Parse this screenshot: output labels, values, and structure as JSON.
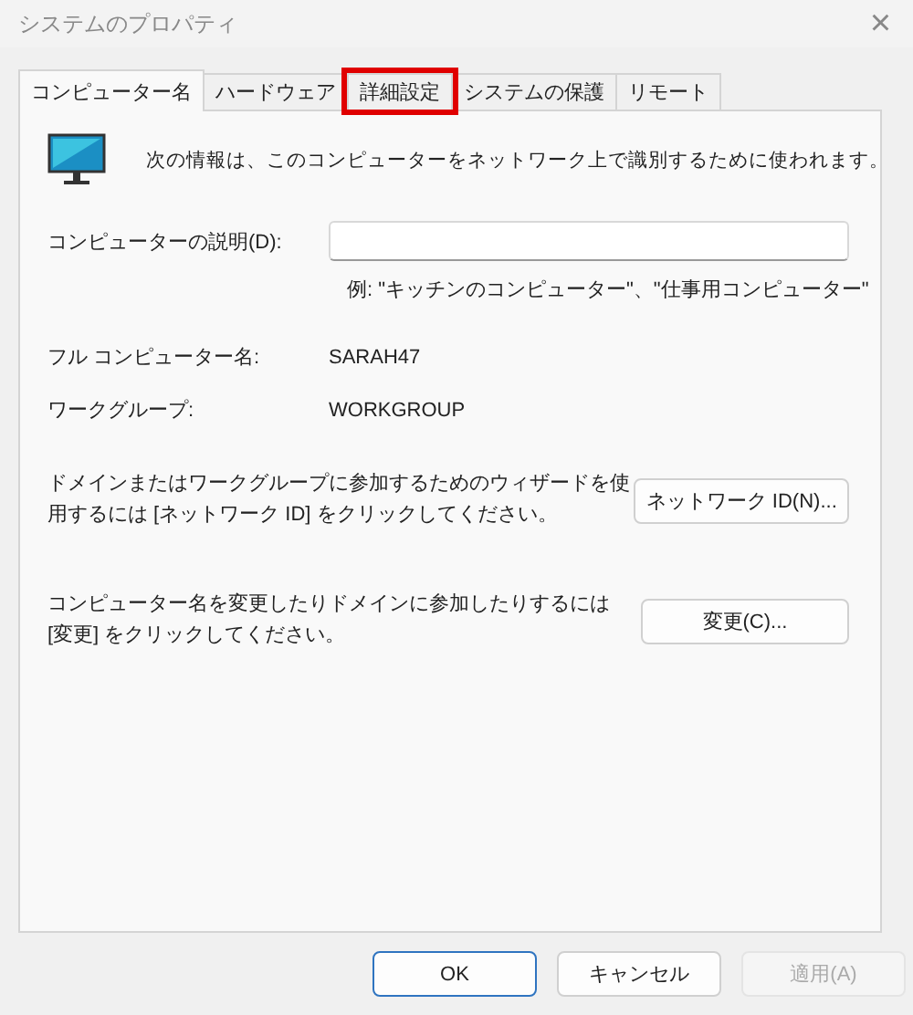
{
  "window": {
    "title": "システムのプロパティ",
    "close": "×"
  },
  "tabs": [
    {
      "label": "コンピューター名",
      "selected": true,
      "highlighted": false
    },
    {
      "label": "ハードウェア",
      "selected": false,
      "highlighted": false
    },
    {
      "label": "詳細設定",
      "selected": false,
      "highlighted": true
    },
    {
      "label": "システムの保護",
      "selected": false,
      "highlighted": false
    },
    {
      "label": "リモート",
      "selected": false,
      "highlighted": false
    }
  ],
  "intro": "次の情報は、このコンピューターをネットワーク上で識別するために使われます。",
  "description": {
    "label": "コンピューターの説明(D):",
    "example": "例: \"キッチンのコンピューター\"、\"仕事用コンピューター\""
  },
  "info": [
    {
      "label": "フル コンピューター名:",
      "value": "SARAH47"
    },
    {
      "label": "ワークグループ:",
      "value": "WORKGROUP"
    }
  ],
  "actions": [
    {
      "text": "ドメインまたはワークグループに参加するためのウィザードを使用するには [ネットワーク ID] をクリックしてください。",
      "button": "ネットワーク ID(N)..."
    },
    {
      "text": "コンピューター名を変更したりドメインに参加したりするには [変更] をクリックしてください。",
      "button": "変更(C)..."
    }
  ],
  "buttons": [
    {
      "label": "OK",
      "default": true,
      "disabled": false
    },
    {
      "label": "キャンセル",
      "default": false,
      "disabled": false
    },
    {
      "label": "適用(A)",
      "default": false,
      "disabled": true
    }
  ]
}
